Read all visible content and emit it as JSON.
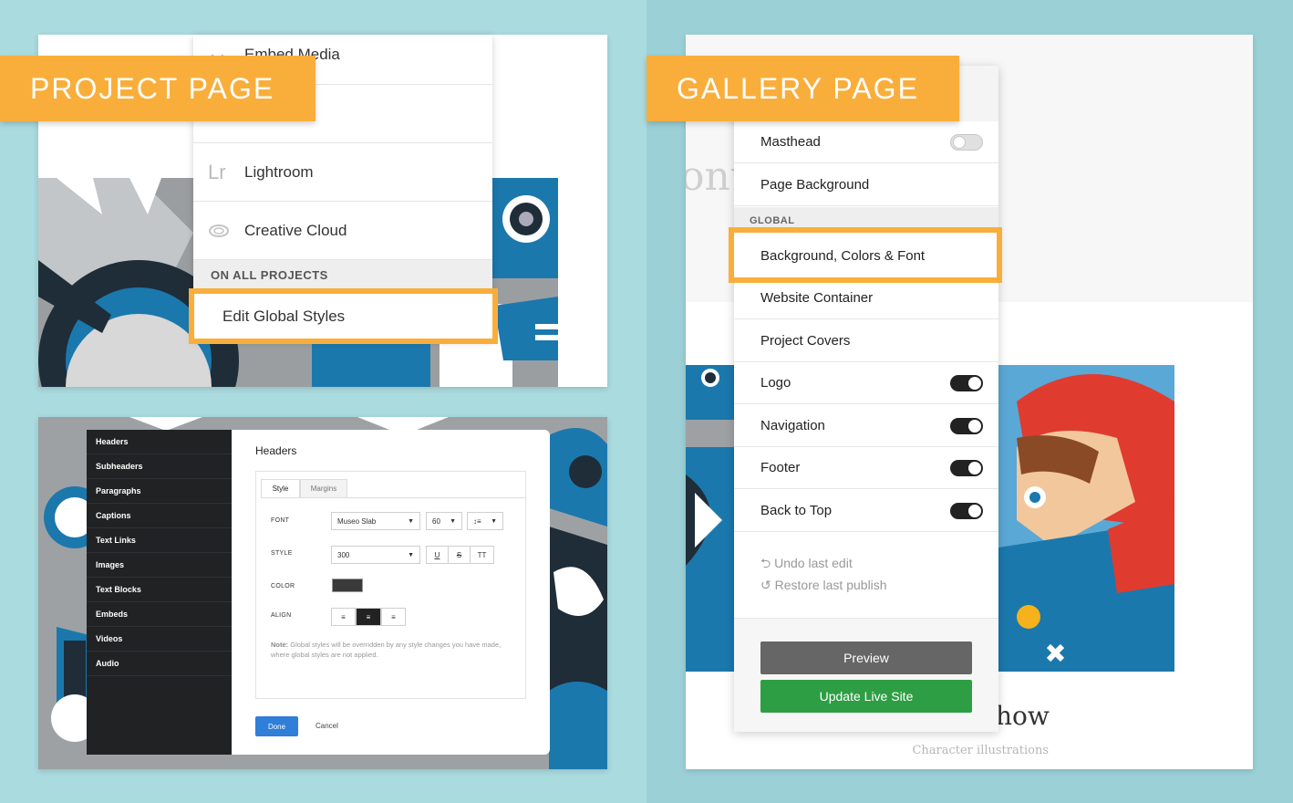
{
  "project_panel": {
    "callout": "PROJECT PAGE",
    "menu": [
      {
        "icon": "embed-icon",
        "label": "Embed Media"
      },
      {
        "icon": "lightroom-icon",
        "label": "Lightroom",
        "icon_text": "Lr"
      },
      {
        "icon": "creative-cloud-icon",
        "label": "Creative Cloud"
      }
    ],
    "section_label": "ON ALL PROJECTS",
    "highlight_item": "Edit Global Styles"
  },
  "styles_panel": {
    "sidebar": [
      "Headers",
      "Subheaders",
      "Paragraphs",
      "Captions",
      "Text Links",
      "Images",
      "Text Blocks",
      "Embeds",
      "Videos",
      "Audio"
    ],
    "title": "Headers",
    "tabs": [
      "Style",
      "Margins"
    ],
    "font_label": "FONT",
    "font_value": "Museo Slab",
    "font_size": "60",
    "style_label": "STYLE",
    "style_value": "300",
    "style_buttons": [
      "U",
      "S",
      "TT"
    ],
    "color_label": "COLOR",
    "color_value": "#3a3a3a",
    "align_label": "ALIGN",
    "note_bold": "Note:",
    "note_text": " Global styles will be overridden by any style changes you have made, where global styles are not applied.",
    "done_label": "Done",
    "cancel_label": "Cancel"
  },
  "gallery_panel": {
    "callout": "GALLERY PAGE",
    "bg_text_left": "ont",
    "bg_text_bottom": "how",
    "bg_caption": "Character illustrations",
    "rows_top": [
      {
        "label": "Masthead",
        "toggle": "off"
      },
      {
        "label": "Page Background"
      }
    ],
    "section_label": "GLOBAL",
    "highlight_item": "Background, Colors & Font",
    "rows_bottom": [
      {
        "label": "Website Container"
      },
      {
        "label": "Project Covers"
      },
      {
        "label": "Logo",
        "toggle": "on"
      },
      {
        "label": "Navigation",
        "toggle": "on"
      },
      {
        "label": "Footer",
        "toggle": "on"
      },
      {
        "label": "Back to Top",
        "toggle": "on"
      }
    ],
    "undo_label": "Undo last edit",
    "restore_label": "Restore last publish",
    "preview_label": "Preview",
    "update_label": "Update Live Site"
  },
  "colors": {
    "accent": "#f9ae3b",
    "preview_button": "#666666",
    "update_button": "#2e9e44",
    "done_button": "#2f7ed8",
    "art_blue": "#1d7fb5"
  }
}
